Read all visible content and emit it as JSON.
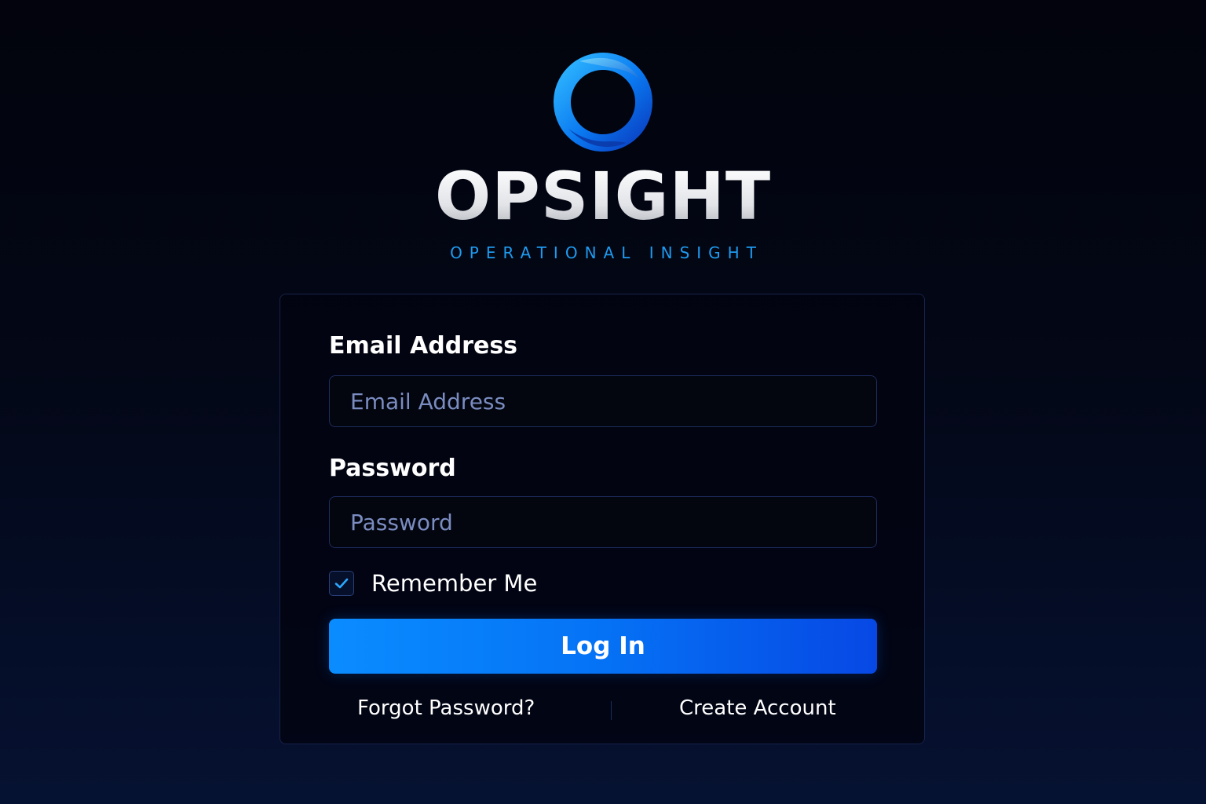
{
  "brand": {
    "name": "OPSIGHT",
    "tagline": "OPERATIONAL INSIGHT",
    "logo_icon": "ring-logo-icon",
    "accent_color": "#1e9bf0"
  },
  "login_form": {
    "email_label": "Email Address",
    "email_placeholder": "Email Address",
    "email_value": "",
    "password_label": "Password",
    "password_placeholder": "Password",
    "password_value": "",
    "remember_me_label": "Remember Me",
    "remember_me_checked": true,
    "submit_label": "Log In",
    "submit_color_start": "#0a8cff",
    "submit_color_end": "#0748e4"
  },
  "footer_links": {
    "forgot_password": "Forgot Password?",
    "create_account": "Create Account"
  }
}
